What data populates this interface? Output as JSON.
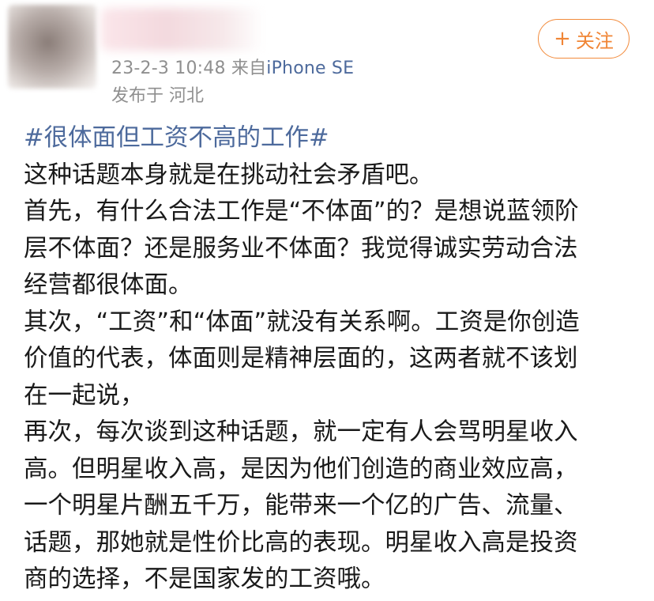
{
  "post": {
    "timestamp": "23-2-3 10:48",
    "from_label": "来自",
    "source": "iPhone SE",
    "location": "发布于 河北",
    "follow_label": "关注",
    "follow_icon": "plus-icon",
    "topic": "#很体面但工资不高的工作#",
    "lines": [
      "这种话题本身就是在挑动社会矛盾吧。",
      "首先，有什么合法工作是“不体面”的？是想说蓝领阶",
      "层不体面？还是服务业不体面？我觉得诚实劳动合法",
      "经营都很体面。",
      "其次，“工资”和“体面”就没有关系啊。工资是你创造",
      "价值的代表，体面则是精神层面的，这两者就不该划",
      "在一起说，",
      "再次，每次谈到这种话题，就一定有人会骂明星收入",
      "高。但明星收入高，是因为他们创造的商业效应高，",
      "一个明星片酬五千万，能带来一个亿的广告、流量、",
      "话题，那她就是性价比高的表现。明星收入高是投资",
      "商的选择，不是国家发的工资哦。"
    ]
  },
  "colors": {
    "link": "#4d6a9c",
    "follow_accent": "#f08535",
    "meta": "#8f8f8f"
  }
}
